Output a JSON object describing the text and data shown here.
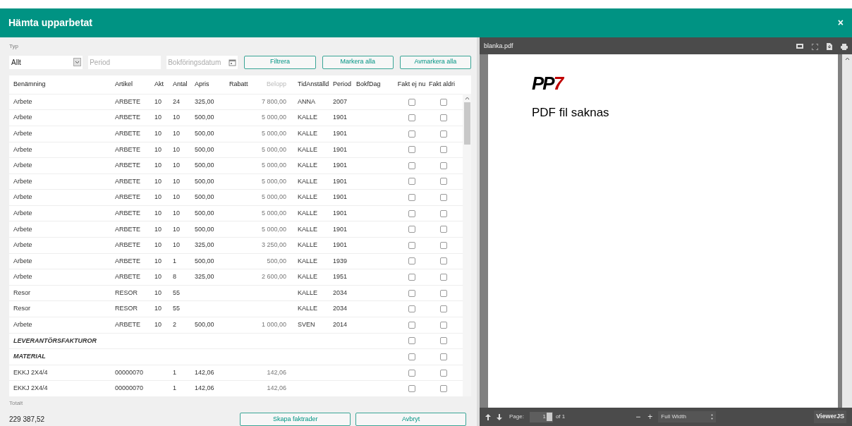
{
  "dialog": {
    "title": "Hämta upparbetat",
    "close": "×"
  },
  "filters": {
    "type_label": "Typ",
    "type_value": "Allt",
    "period_placeholder": "Period",
    "date_placeholder": "Bokföringsdatum",
    "buttons": [
      "Filtrera",
      "Markera alla",
      "Avmarkera alla"
    ]
  },
  "table": {
    "columns": [
      {
        "label": "Benämning",
        "disabled": false
      },
      {
        "label": "Artikel",
        "disabled": false
      },
      {
        "label": "Akt",
        "disabled": false
      },
      {
        "label": "Antal",
        "disabled": false
      },
      {
        "label": "Apris",
        "disabled": false
      },
      {
        "label": "Rabatt",
        "disabled": false
      },
      {
        "label": "Belopp",
        "disabled": true
      },
      {
        "label": "TidAnställd",
        "disabled": false
      },
      {
        "label": "Period",
        "disabled": false
      },
      {
        "label": "BokfDag",
        "disabled": false
      },
      {
        "label": "Fakt ej nu",
        "disabled": false
      },
      {
        "label": "Fakt aldri",
        "disabled": false
      }
    ],
    "rows": [
      {
        "kind": "item",
        "cells": [
          "Arbete",
          "ARBETE",
          "10",
          "24",
          "325,00",
          "",
          "7 800,00",
          "ANNA",
          "2007",
          ""
        ],
        "fakt_ej_nu": false,
        "fakt_aldrig": false
      },
      {
        "kind": "item",
        "cells": [
          "Arbete",
          "ARBETE",
          "10",
          "10",
          "500,00",
          "",
          "5 000,00",
          "KALLE",
          "1901",
          ""
        ],
        "fakt_ej_nu": false,
        "fakt_aldrig": false
      },
      {
        "kind": "item",
        "cells": [
          "Arbete",
          "ARBETE",
          "10",
          "10",
          "500,00",
          "",
          "5 000,00",
          "KALLE",
          "1901",
          ""
        ],
        "fakt_ej_nu": false,
        "fakt_aldrig": false
      },
      {
        "kind": "item",
        "cells": [
          "Arbete",
          "ARBETE",
          "10",
          "10",
          "500,00",
          "",
          "5 000,00",
          "KALLE",
          "1901",
          ""
        ],
        "fakt_ej_nu": false,
        "fakt_aldrig": false
      },
      {
        "kind": "item",
        "cells": [
          "Arbete",
          "ARBETE",
          "10",
          "10",
          "500,00",
          "",
          "5 000,00",
          "KALLE",
          "1901",
          ""
        ],
        "fakt_ej_nu": false,
        "fakt_aldrig": false
      },
      {
        "kind": "item",
        "cells": [
          "Arbete",
          "ARBETE",
          "10",
          "10",
          "500,00",
          "",
          "5 000,00",
          "KALLE",
          "1901",
          ""
        ],
        "fakt_ej_nu": false,
        "fakt_aldrig": false
      },
      {
        "kind": "item",
        "cells": [
          "Arbete",
          "ARBETE",
          "10",
          "10",
          "500,00",
          "",
          "5 000,00",
          "KALLE",
          "1901",
          ""
        ],
        "fakt_ej_nu": false,
        "fakt_aldrig": false
      },
      {
        "kind": "item",
        "cells": [
          "Arbete",
          "ARBETE",
          "10",
          "10",
          "500,00",
          "",
          "5 000,00",
          "KALLE",
          "1901",
          ""
        ],
        "fakt_ej_nu": false,
        "fakt_aldrig": false
      },
      {
        "kind": "item",
        "cells": [
          "Arbete",
          "ARBETE",
          "10",
          "10",
          "500,00",
          "",
          "5 000,00",
          "KALLE",
          "1901",
          ""
        ],
        "fakt_ej_nu": false,
        "fakt_aldrig": false
      },
      {
        "kind": "item",
        "cells": [
          "Arbete",
          "ARBETE",
          "10",
          "10",
          "325,00",
          "",
          "3 250,00",
          "KALLE",
          "1901",
          ""
        ],
        "fakt_ej_nu": false,
        "fakt_aldrig": false
      },
      {
        "kind": "item",
        "cells": [
          "Arbete",
          "ARBETE",
          "10",
          "1",
          "500,00",
          "",
          "500,00",
          "KALLE",
          "1939",
          ""
        ],
        "fakt_ej_nu": false,
        "fakt_aldrig": false
      },
      {
        "kind": "item",
        "cells": [
          "Arbete",
          "ARBETE",
          "10",
          "8",
          "325,00",
          "",
          "2 600,00",
          "KALLE",
          "1951",
          ""
        ],
        "fakt_ej_nu": false,
        "fakt_aldrig": false
      },
      {
        "kind": "item",
        "cells": [
          "Resor",
          "RESOR",
          "10",
          "55",
          "",
          "",
          "",
          "KALLE",
          "2034",
          ""
        ],
        "fakt_ej_nu": false,
        "fakt_aldrig": false
      },
      {
        "kind": "item",
        "cells": [
          "Resor",
          "RESOR",
          "10",
          "55",
          "",
          "",
          "",
          "KALLE",
          "2034",
          ""
        ],
        "fakt_ej_nu": false,
        "fakt_aldrig": false
      },
      {
        "kind": "item",
        "cells": [
          "Arbete",
          "ARBETE",
          "10",
          "2",
          "500,00",
          "",
          "1 000,00",
          "SVEN",
          "2014",
          ""
        ],
        "fakt_ej_nu": false,
        "fakt_aldrig": false
      },
      {
        "kind": "group",
        "cells": [
          "LEVERANTÖRSFAKTUROR"
        ],
        "fakt_ej_nu": false,
        "fakt_aldrig": false
      },
      {
        "kind": "group",
        "cells": [
          "MATERIAL"
        ],
        "fakt_ej_nu": false,
        "fakt_aldrig": false
      },
      {
        "kind": "item",
        "cells": [
          "EKKJ 2X4/4",
          "00000070",
          "",
          "1",
          "142,06",
          "",
          "142,06",
          "",
          "",
          ""
        ],
        "fakt_ej_nu": false,
        "fakt_aldrig": false
      },
      {
        "kind": "item",
        "cells": [
          "EKKJ 2X4/4",
          "00000070",
          "",
          "1",
          "142,06",
          "",
          "142,06",
          "",
          "",
          ""
        ],
        "fakt_ej_nu": false,
        "fakt_aldrig": false
      }
    ]
  },
  "footer": {
    "total_label": "Totalt",
    "total": "229 387,52",
    "buttons": [
      "Skapa faktrader",
      "Avbryt"
    ]
  },
  "viewer": {
    "filename": "blanka.pdf",
    "logo": [
      "PP",
      "7"
    ],
    "message": "PDF fil saknas",
    "page_label": "Page:",
    "page": "1",
    "page_of": "of 1",
    "zoom_out": "−",
    "zoom_in": "+",
    "zoom": "Full Width",
    "brand": "ViewerJS"
  }
}
